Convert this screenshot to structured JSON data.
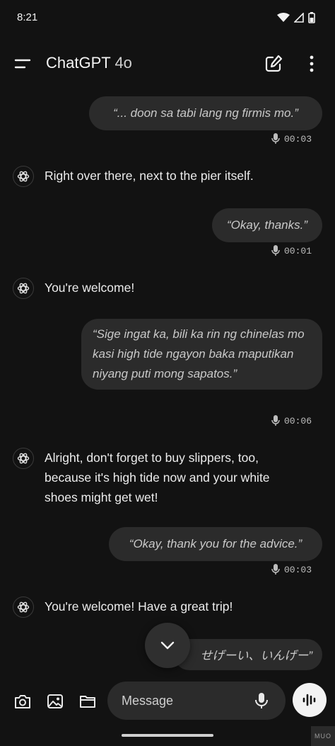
{
  "status_bar": {
    "time": "8:21"
  },
  "header": {
    "title": "ChatGPT",
    "model": "4o"
  },
  "messages": {
    "u1": {
      "text": "“... doon sa tabi lang ng firmis mo.”",
      "duration": "00:03"
    },
    "a1": {
      "text": "Right over there, next to the pier itself."
    },
    "u2": {
      "text": "“Okay, thanks.”",
      "duration": "00:01"
    },
    "a2": {
      "text": "You're welcome!"
    },
    "u3": {
      "text": "“Sige ingat ka, bili ka rin ng chinelas mo kasi high tide ngayon baka maputikan niyang puti mong sapatos.”",
      "duration": "00:06"
    },
    "a3": {
      "text": "Alright, don't forget to buy slippers, too, because it's high tide now and your white shoes might get wet!"
    },
    "u4": {
      "text": "“Okay, thank you for the advice.”",
      "duration": "00:03"
    },
    "a4": {
      "text": "You're welcome! Have a great trip!"
    },
    "u5": {
      "text": "せげーい、いんげー”"
    }
  },
  "composer": {
    "placeholder": "Message"
  },
  "watermark": "MUO",
  "colors": {
    "background": "#121212",
    "bubble": "#2b2b2b",
    "voice_button": "#f3f3f3"
  }
}
